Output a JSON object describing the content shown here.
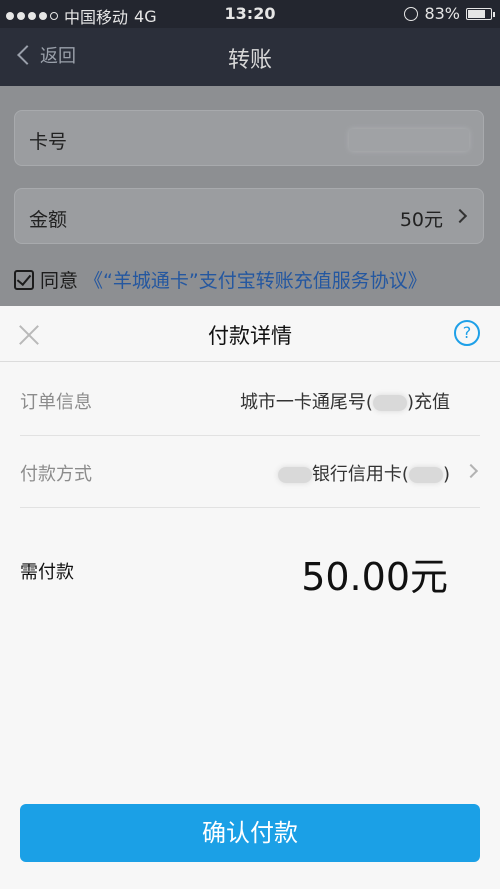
{
  "status_bar": {
    "carrier": "中国移动",
    "network": "4G",
    "time": "13:20",
    "battery": "83%",
    "battery_level": 0.83
  },
  "navbar": {
    "back_label": "返回",
    "title": "转账"
  },
  "form": {
    "card_label": "卡号",
    "amount_label": "金额",
    "amount_value": "50元",
    "agree_text": "同意",
    "agreement_link": "《“羊城通卡”支付宝转账充值服务协议》"
  },
  "sheet": {
    "title": "付款详情",
    "help_symbol": "?",
    "order_label": "订单信息",
    "order_value_prefix": "城市一卡通尾号(",
    "order_value_suffix": ")充值",
    "method_label": "付款方式",
    "method_value_prefix": "银行信用卡(",
    "method_value_suffix": ")",
    "due_label": "需付款",
    "due_amount": "50.00元",
    "confirm_label": "确认付款"
  },
  "colors": {
    "accent": "#1ba0e6",
    "nav_bg": "#2b2f3a",
    "link": "#2457a0"
  }
}
